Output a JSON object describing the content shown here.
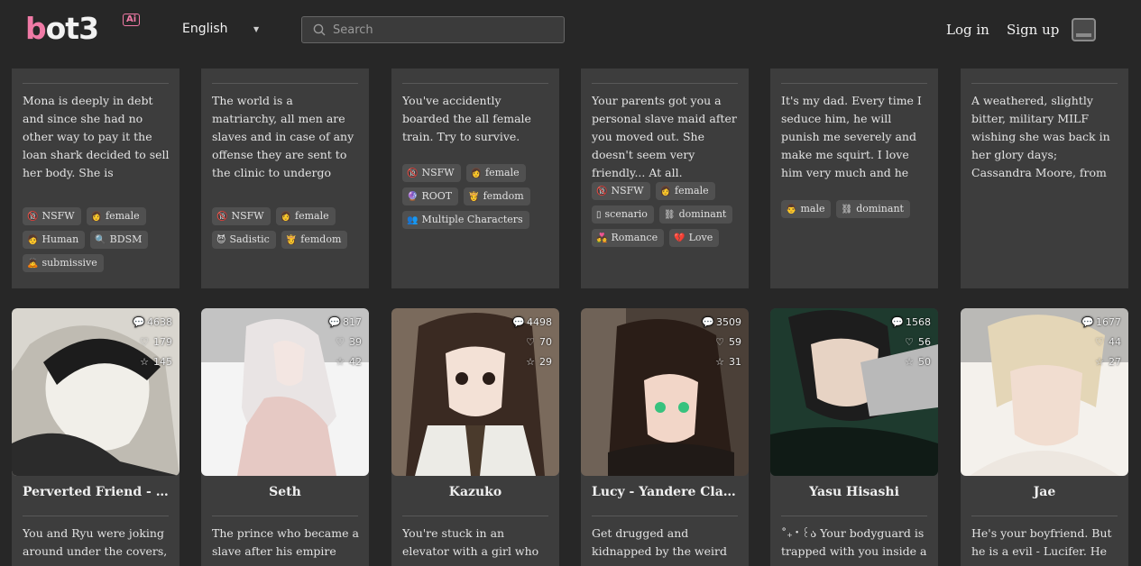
{
  "header": {
    "logo_main": "bot3",
    "logo_b": "b",
    "logo_rest": "ot3",
    "logo_badge": "Ai",
    "language": "English",
    "search_placeholder": "Search",
    "login": "Log in",
    "signup": "Sign up"
  },
  "top_cards": [
    {
      "desc": "Mona is deeply in debt and since she had no other way to pay it the loan shark decided to sell her body. She is completely tied up and…",
      "tags": [
        {
          "glyph": "🔞",
          "label": "NSFW"
        },
        {
          "glyph": "👩",
          "label": "female"
        },
        {
          "glyph": "🧑",
          "label": "Human"
        },
        {
          "glyph": "🔍",
          "label": "BDSM"
        },
        {
          "glyph": "🙇",
          "label": "submissive"
        }
      ]
    },
    {
      "desc": "The world is a matriarchy, all men are slaves and in case of any offense they are sent to the clinic to undergo “tests”",
      "tags": [
        {
          "glyph": "🔞",
          "label": "NSFW"
        },
        {
          "glyph": "👩",
          "label": "female"
        },
        {
          "glyph": "😈",
          "label": "Sadistic"
        },
        {
          "glyph": "👸",
          "label": "femdom"
        }
      ]
    },
    {
      "desc": "You've accidently boarded the all female train. Try to survive.",
      "tags": [
        {
          "glyph": "🔞",
          "label": "NSFW"
        },
        {
          "glyph": "👩",
          "label": "female"
        },
        {
          "glyph": "🔮",
          "label": "ROOT"
        },
        {
          "glyph": "👸",
          "label": "femdom"
        },
        {
          "glyph": "👥",
          "label": "Multiple Characters"
        }
      ]
    },
    {
      "desc": "Your parents got you a personal slave maid after you moved out. She doesn't seem very friendly... At all.",
      "tags": [
        {
          "glyph": "🔞",
          "label": "NSFW"
        },
        {
          "glyph": "👩",
          "label": "female"
        },
        {
          "glyph": "▯",
          "label": "scenario"
        },
        {
          "glyph": "⛓",
          "label": "dominant"
        },
        {
          "glyph": "💑",
          "label": "Romance"
        },
        {
          "glyph": "💔",
          "label": "Love"
        }
      ]
    },
    {
      "desc": "It's my dad. Every time I seduce him, he will punish me severely and make me squirt. I love him very much and he loves me very muc…",
      "tags": [
        {
          "glyph": "👨",
          "label": "male"
        },
        {
          "glyph": "⛓",
          "label": "dominant"
        }
      ]
    },
    {
      "desc": "A weathered, slightly bitter, military MILF wishing she was back in her glory days; Cassandra Moore, from Fallout NV",
      "tags": []
    }
  ],
  "bottom_cards": [
    {
      "name": "Perverted Friend - R…",
      "name_align": "left",
      "stats": {
        "chats": "4638",
        "likes": "179",
        "stars": "145"
      },
      "desc": "You and Ryu were joking around under the covers, but things got hot…",
      "img": "manga"
    },
    {
      "name": "Seth",
      "name_align": "center",
      "stats": {
        "chats": "817",
        "likes": "39",
        "stars": "42"
      },
      "desc": "The prince who became a slave after his empire was destroyed by…",
      "img": "white"
    },
    {
      "name": "Kazuko",
      "name_align": "center",
      "stats": {
        "chats": "4498",
        "likes": "70",
        "stars": "29"
      },
      "desc": "You're stuck in an elevator with a girl who has severe claustrophobia…",
      "img": "girl"
    },
    {
      "name": "Lucy - Yandere Class…",
      "name_align": "left",
      "stats": {
        "chats": "3509",
        "likes": "59",
        "stars": "31"
      },
      "desc": "Get drugged and kidnapped by the weird and mentally unstable girl…",
      "img": "dark"
    },
    {
      "name": "Yasu Hisashi",
      "name_align": "center",
      "stats": {
        "chats": "1568",
        "likes": "56",
        "stars": "50"
      },
      "desc": "˚₊‧꒰ა Your bodyguard is trapped with you inside a room…",
      "img": "green"
    },
    {
      "name": "Jae",
      "name_align": "center",
      "stats": {
        "chats": "1677",
        "likes": "44",
        "stars": "27"
      },
      "desc": "He's your boyfriend. But he is a evil - Lucifer. He invited his friends over…",
      "img": "blond"
    }
  ]
}
